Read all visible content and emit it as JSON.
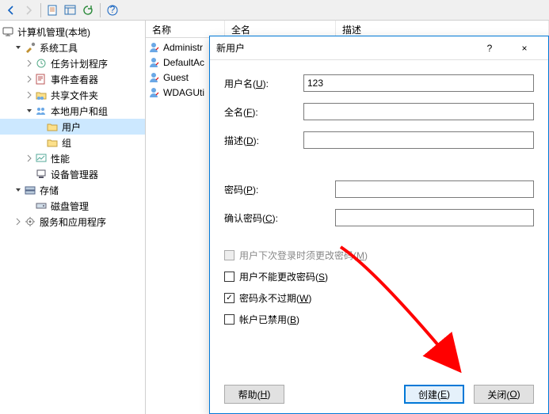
{
  "toolbar": {},
  "nav": {
    "root": "计算机管理(本地)",
    "sys_tools": "系统工具",
    "task_sched": "任务计划程序",
    "event_viewer": "事件查看器",
    "shared": "共享文件夹",
    "local_usrgrp": "本地用户和组",
    "users": "用户",
    "groups": "组",
    "perf": "性能",
    "devmgr": "设备管理器",
    "storage": "存储",
    "diskmgmt": "磁盘管理",
    "services": "服务和应用程序"
  },
  "detail": {
    "col_name": "名称",
    "col_full": "全名",
    "col_desc": "描述",
    "rows": [
      {
        "name": "Administrator"
      },
      {
        "name": "DefaultAccount"
      },
      {
        "name": "Guest"
      },
      {
        "name": "WDAGUtilityAccount"
      }
    ],
    "row0": "Administr",
    "row1": "DefaultAc",
    "row2": "Guest",
    "row3": "WDAGUti"
  },
  "dialog": {
    "title": "新用户",
    "help": "?",
    "close": "×",
    "fields": {
      "username_lbl": "用户名(U):",
      "username_val": "123",
      "fullname_lbl": "全名(F):",
      "fullname_val": "",
      "desc_lbl": "描述(D):",
      "desc_val": "",
      "pwd_lbl": "密码(P):",
      "pwd_val": "",
      "cpwd_lbl": "确认密码(C):",
      "cpwd_val": ""
    },
    "checkboxes": {
      "must_change": {
        "label": "用户下次登录时须更改密码(M)",
        "checked": false,
        "disabled": true
      },
      "cannot_change": {
        "label": "用户不能更改密码(S)",
        "checked": false,
        "disabled": false
      },
      "never_expire": {
        "label": "密码永不过期(W)",
        "checked": true,
        "disabled": false
      },
      "disabled_acct": {
        "label": "帐户已禁用(B)",
        "checked": false,
        "disabled": false
      }
    },
    "buttons": {
      "help": "帮助(H)",
      "create": "创建(E)",
      "close": "关闭(O)"
    }
  }
}
